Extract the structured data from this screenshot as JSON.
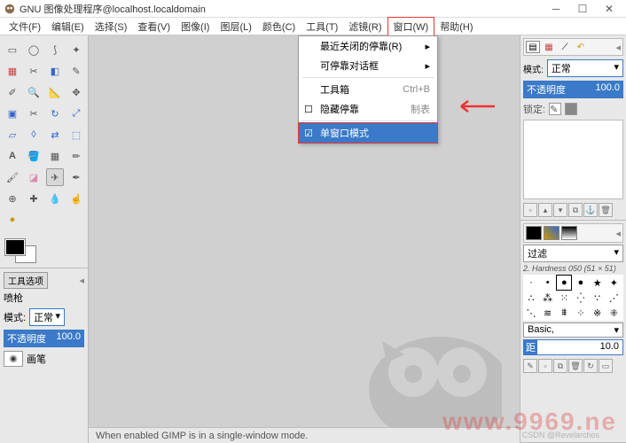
{
  "window": {
    "title": "GNU 图像处理程序@localhost.localdomain"
  },
  "menubar": {
    "items": [
      "文件(F)",
      "编辑(E)",
      "选择(S)",
      "查看(V)",
      "图像(I)",
      "图层(L)",
      "颜色(C)",
      "工具(T)",
      "滤镜(R)",
      "窗口(W)",
      "帮助(H)"
    ]
  },
  "dropdown": {
    "items": [
      {
        "label": "最近关闭的停靠(R)",
        "submenu": true
      },
      {
        "label": "可停靠对话框",
        "submenu": true
      },
      {
        "label": "工具箱",
        "shortcut": "Ctrl+B"
      },
      {
        "label": "隐藏停靠",
        "shortcut": "制表",
        "checkbox": true,
        "checked": false
      },
      {
        "label": "单窗口模式",
        "checkbox": true,
        "checked": true,
        "highlight": true
      }
    ]
  },
  "tool_options": {
    "tab_label": "工具选项",
    "tool_name": "喷枪",
    "mode_label": "模式:",
    "mode_value": "正常",
    "opacity_label": "不透明度",
    "opacity_value": "100.0",
    "brush_label": "画笔"
  },
  "right": {
    "layers": {
      "mode_label": "模式:",
      "mode_value": "正常",
      "opacity_label": "不透明度",
      "opacity_value": "100.0",
      "lock_label": "锁定:"
    },
    "brushes": {
      "filter_label": "过滤",
      "name": "2. Hardness 050 (51 × 51)",
      "preset_label": "Basic,",
      "spacing_label": "距",
      "spacing_value": "10.0"
    }
  },
  "statusbar": {
    "text": "When enabled GIMP is in a single-window mode."
  },
  "watermark": "www.9969.ne",
  "watermark2": "CSDN @Revelarchos"
}
